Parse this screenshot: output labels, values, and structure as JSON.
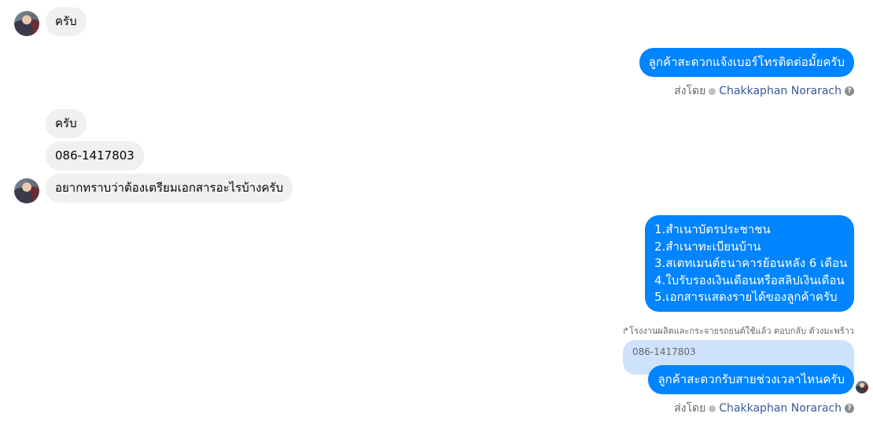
{
  "messages": {
    "m1": "ครับ",
    "m2": "ลูกค้าสะดวกแจ้งเบอร์โทรติดต่อมั้ยครับ",
    "m3": "ครับ",
    "m4": "086-1417803",
    "m5": "อยากทราบว่าต้องเตรียมเอกสารอะไรบ้างครับ",
    "m6_lines": [
      "1.สำเนาบัตรประชาชน",
      "2.สำเนาทะเบียนบ้าน",
      "3.สเตทเมนต์ธนาคารย้อนหลัง 6 เดือน",
      "4.ใบรับรองเงินเดือนหรือสลิปเงินเดือน",
      "5.เอกสารแสดงรายได้ของลูกค้าครับ"
    ],
    "reply_meta": "โรงงานผลิตและกระจายรถยนต์ใช้แล้ว ตอบกลับ ตัวงมะพร้าว",
    "reply_quote": "086-1417803",
    "m7": "ลูกค้าสะดวกรับสายช่วงเวลาไหนครับ"
  },
  "sent_by": {
    "label": "ส่งโดย",
    "name": "Chakkaphan Norarach",
    "help": "?"
  },
  "colors": {
    "outgoing": "#0084ff",
    "incoming": "#f0f0f0",
    "reply_quote_bg": "#cfe2fb",
    "sender_name": "#385898"
  }
}
